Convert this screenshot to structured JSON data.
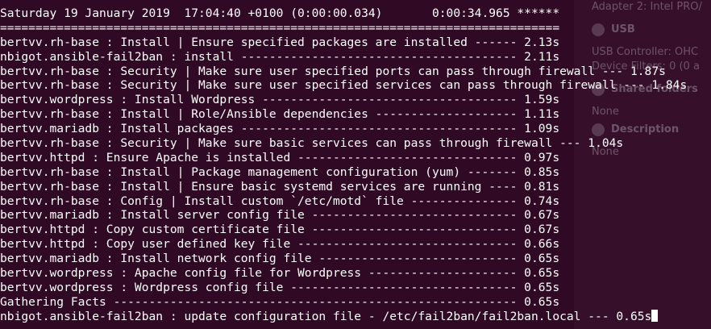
{
  "background_window": {
    "rows": [
      {
        "kind": "text",
        "text": "Adapter 2:  Intel PRO/"
      },
      {
        "kind": "header",
        "icon": "usb-icon",
        "text": "USB"
      },
      {
        "kind": "text",
        "text": "USB Controller:   OHC"
      },
      {
        "kind": "text",
        "text": "Device Filters:   0 (0 a"
      },
      {
        "kind": "header",
        "icon": "shared-folders-icon",
        "text": "Shared folders"
      },
      {
        "kind": "text",
        "text": "None"
      },
      {
        "kind": "header",
        "icon": "description-icon",
        "text": "Description"
      },
      {
        "kind": "text",
        "text": "None"
      }
    ]
  },
  "terminal": {
    "lines": [
      "Saturday 19 January 2019  17:04:40 +0100 (0:00:00.034)       0:00:34.965 ******",
      "===============================================================================",
      "bertvv.rh-base : Install | Ensure specified packages are installed ------ 2.13s",
      "nbigot.ansible-fail2ban : install --------------------------------------- 2.11s",
      "bertvv.rh-base : Security | Make sure user specified ports can pass through firewall --- 1.87s",
      "bertvv.rh-base : Security | Make sure user specified services can pass through firewall --- 1.84s",
      "bertvv.wordpress : Install Wordpress ------------------------------------ 1.59s",
      "bertvv.rh-base : Install | Role/Ansible dependencies -------------------- 1.11s",
      "bertvv.mariadb : Install packages --------------------------------------- 1.09s",
      "bertvv.rh-base : Security | Make sure basic services can pass through firewall --- 1.04s",
      "bertvv.httpd : Ensure Apache is installed ------------------------------- 0.97s",
      "bertvv.rh-base : Install | Package management configuration (yum) ------- 0.85s",
      "bertvv.rh-base : Install | Ensure basic systemd services are running ---- 0.81s",
      "bertvv.rh-base : Config | Install custom `/etc/motd` file --------------- 0.74s",
      "bertvv.mariadb : Install server config file ----------------------------- 0.67s",
      "bertvv.httpd : Copy custom certificate file ----------------------------- 0.67s",
      "bertvv.httpd : Copy user defined key file ------------------------------- 0.66s",
      "bertvv.mariadb : Install network config file ---------------------------- 0.65s",
      "bertvv.wordpress : Apache config file for Wordpress --------------------- 0.65s",
      "bertvv.wordpress : Wordpress config file -------------------------------- 0.65s",
      "Gathering Facts --------------------------------------------------------- 0.65s",
      "nbigot.ansible-fail2ban : update configuration file - /etc/fail2ban/fail2ban.local --- 0.65s"
    ]
  },
  "colors": {
    "terminal_bg": "#300a24",
    "terminal_fg": "#ffffff",
    "prompt_user": "#7fd23a"
  }
}
